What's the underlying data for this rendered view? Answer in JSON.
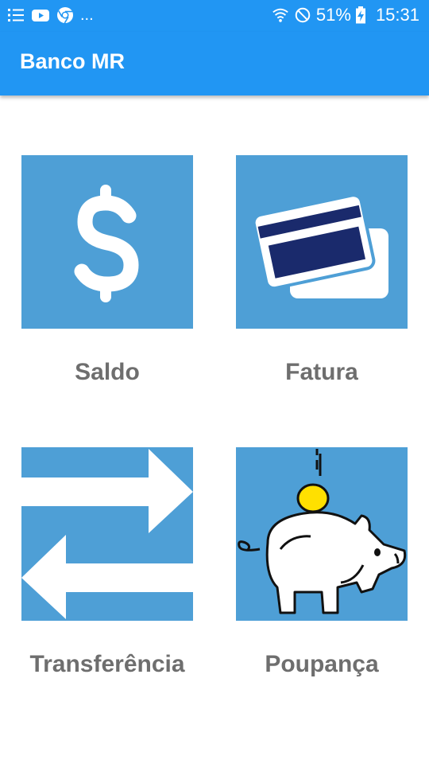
{
  "status_bar": {
    "notifications_more": "...",
    "battery": "51%",
    "time": "15:31",
    "icons": [
      "list-icon",
      "youtube-icon",
      "chrome-icon",
      "wifi-icon",
      "do-not-disturb-icon",
      "battery-charging-icon"
    ]
  },
  "app_bar": {
    "title": "Banco MR"
  },
  "menu": {
    "items": [
      {
        "label": "Saldo",
        "icon": "dollar-icon"
      },
      {
        "label": "Fatura",
        "icon": "credit-card-icon"
      },
      {
        "label": "Transferência",
        "icon": "transfer-arrows-icon"
      },
      {
        "label": "Poupança",
        "icon": "piggy-bank-icon"
      }
    ]
  },
  "colors": {
    "primary": "#2196f3",
    "tile_background": "#4e9fd6",
    "label_text": "#6e6e6e",
    "card_navy": "#1a2a6c",
    "coin": "#ffe000"
  }
}
